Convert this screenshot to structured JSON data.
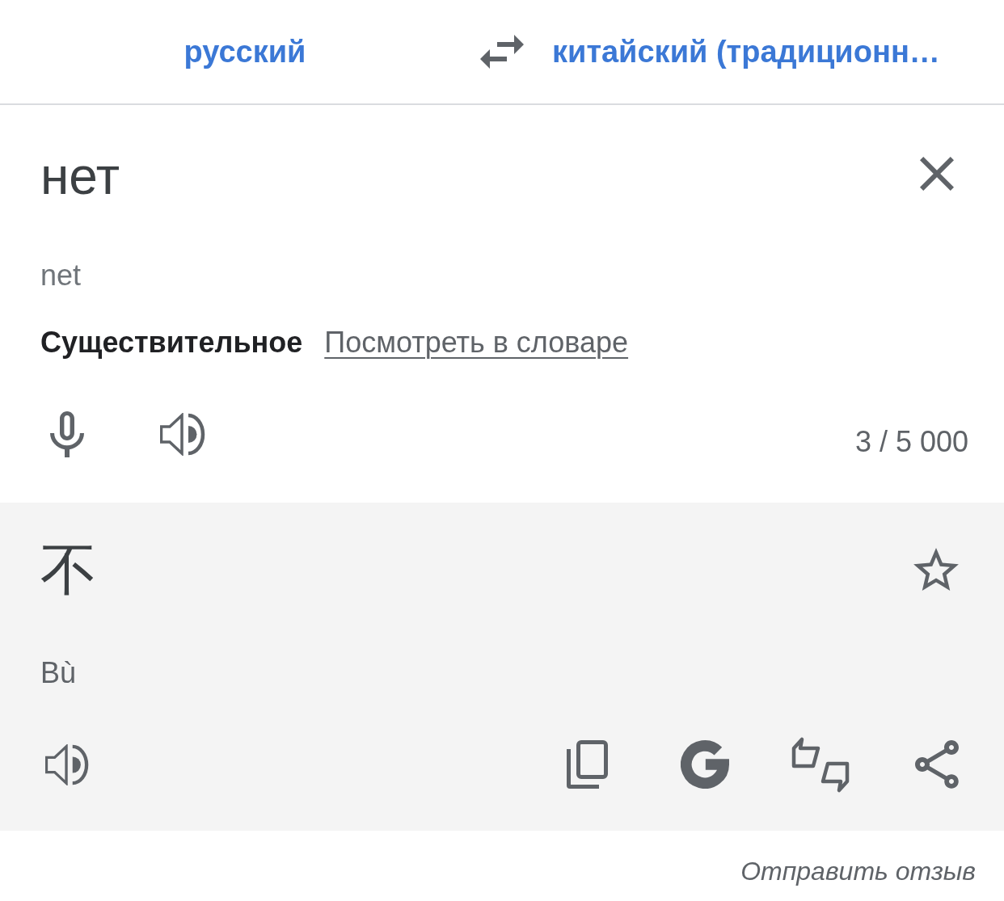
{
  "header": {
    "source_language": "русский",
    "target_language": "китайский (традиционн…"
  },
  "input": {
    "text": "нет",
    "transliteration": "net",
    "part_of_speech": "Существительное",
    "dictionary_link": "Посмотреть в словаре",
    "char_count": "3 / 5 000"
  },
  "output": {
    "text": "不",
    "starred": false,
    "romanization": "Bù"
  },
  "footer": {
    "feedback_link": "Отправить отзыв"
  }
}
